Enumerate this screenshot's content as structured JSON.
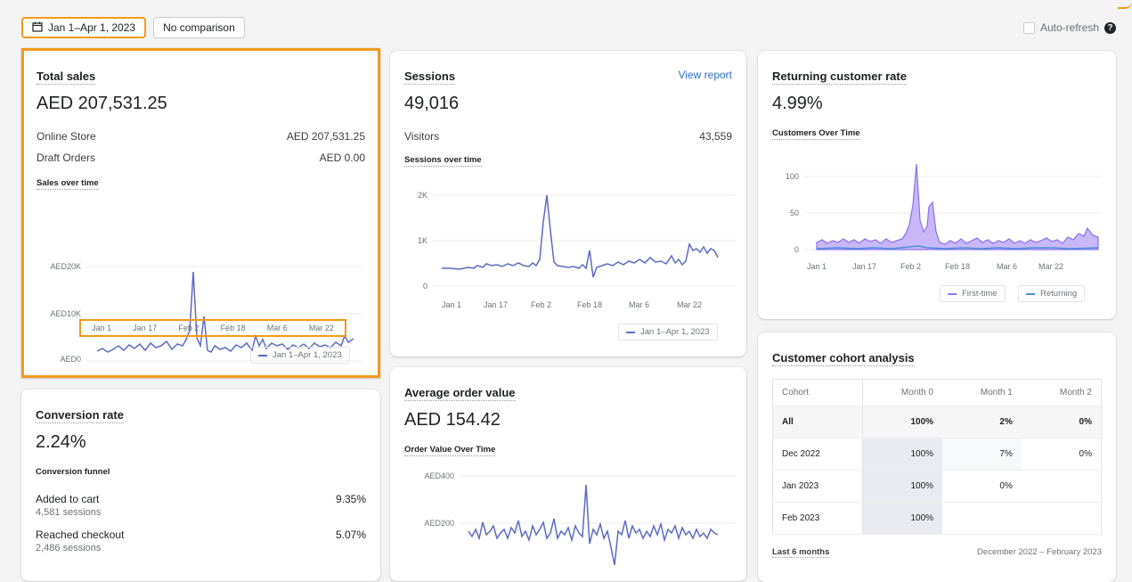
{
  "topbar": {
    "date_range": "Jan 1–Apr 1, 2023",
    "comparison": "No comparison",
    "auto_refresh": "Auto-refresh",
    "help": "?"
  },
  "total_sales": {
    "title": "Total sales",
    "value": "AED 207,531.25",
    "rows": [
      {
        "label": "Online Store",
        "value": "AED 207,531.25"
      },
      {
        "label": "Draft Orders",
        "value": "AED 0.00"
      }
    ],
    "chart_title": "Sales over time",
    "y_ticks": [
      "AED20K",
      "AED10K",
      "AED0"
    ],
    "x_ticks": [
      "Jan 1",
      "Jan 17",
      "Feb 2",
      "Feb 18",
      "Mar 6",
      "Mar 22"
    ],
    "legend": "Jan 1–Apr 1, 2023"
  },
  "sessions": {
    "title": "Sessions",
    "view_report": "View report",
    "value": "49,016",
    "rows": [
      {
        "label": "Visitors",
        "value": "43,559"
      }
    ],
    "chart_title": "Sessions over time",
    "y_ticks": [
      "2K",
      "1K",
      "0"
    ],
    "x_ticks": [
      "Jan 1",
      "Jan 17",
      "Feb 2",
      "Feb 18",
      "Mar 6",
      "Mar 22"
    ],
    "legend": "Jan 1–Apr 1, 2023"
  },
  "returning": {
    "title": "Returning customer rate",
    "value": "4.99%",
    "chart_title": "Customers Over Time",
    "y_ticks": [
      "100",
      "50",
      "0"
    ],
    "x_ticks": [
      "Jan 1",
      "Jan 17",
      "Feb 2",
      "Feb 18",
      "Mar 6",
      "Mar 22"
    ],
    "legend_first": "First-time",
    "legend_returning": "Returning"
  },
  "conversion": {
    "title": "Conversion rate",
    "value": "2.24%",
    "funnel_title": "Conversion funnel",
    "steps": [
      {
        "label": "Added to cart",
        "sub": "4,581 sessions",
        "value": "9.35%"
      },
      {
        "label": "Reached checkout",
        "sub": "2,486 sessions",
        "value": "5.07%"
      }
    ]
  },
  "aov": {
    "title": "Average order value",
    "value": "AED 154.42",
    "chart_title": "Order Value Over Time",
    "y_ticks": [
      "AED400",
      "AED200"
    ]
  },
  "cohort": {
    "title": "Customer cohort analysis",
    "headers": [
      "Cohort",
      "Month 0",
      "Month 1",
      "Month 2"
    ],
    "rows": [
      [
        "All",
        "100%",
        "2%",
        "0%"
      ],
      [
        "Dec 2022",
        "100%",
        "7%",
        "0%"
      ],
      [
        "Jan 2023",
        "100%",
        "0%",
        ""
      ],
      [
        "Feb 2023",
        "100%",
        "",
        ""
      ]
    ],
    "footer_left": "Last 6 months",
    "footer_right": "December 2022 – February 2023"
  },
  "colors": {
    "accent": "#5c6ac4",
    "highlight": "#f39a1c",
    "link": "#2c6ecb"
  }
}
